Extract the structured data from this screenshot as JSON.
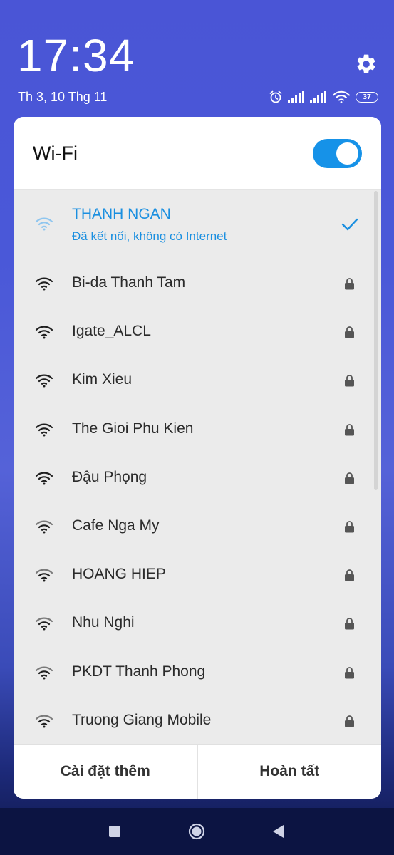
{
  "status": {
    "time": "17:34",
    "date": "Th 3, 10 Thg 11",
    "battery": "37"
  },
  "panel": {
    "title": "Wi-Fi",
    "toggle_on": true
  },
  "networks": [
    {
      "ssid": "THANH NGAN",
      "status": "Đã kết nối, không có Internet",
      "connected": true,
      "secured": false
    },
    {
      "ssid": "Bi-da Thanh Tam",
      "secured": true
    },
    {
      "ssid": "Igate_ALCL",
      "secured": true
    },
    {
      "ssid": "Kim Xieu",
      "secured": true
    },
    {
      "ssid": "The Gioi Phu Kien",
      "secured": true
    },
    {
      "ssid": "Đậu Phọng",
      "secured": true
    },
    {
      "ssid": "Cafe Nga My",
      "secured": true
    },
    {
      "ssid": "HOANG HIEP",
      "secured": true
    },
    {
      "ssid": "Nhu Nghi",
      "secured": true
    },
    {
      "ssid": "PKDT Thanh Phong",
      "secured": true
    },
    {
      "ssid": "Truong Giang Mobile",
      "secured": true
    }
  ],
  "footer": {
    "more_settings": "Cài đặt thêm",
    "done": "Hoàn tất"
  },
  "colors": {
    "accent": "#1692e8",
    "connected_text": "#1a8fe0"
  },
  "icons": [
    "gear-icon",
    "alarm-icon",
    "signal-icon",
    "wifi-icon",
    "battery-icon",
    "lock-icon",
    "check-icon"
  ]
}
